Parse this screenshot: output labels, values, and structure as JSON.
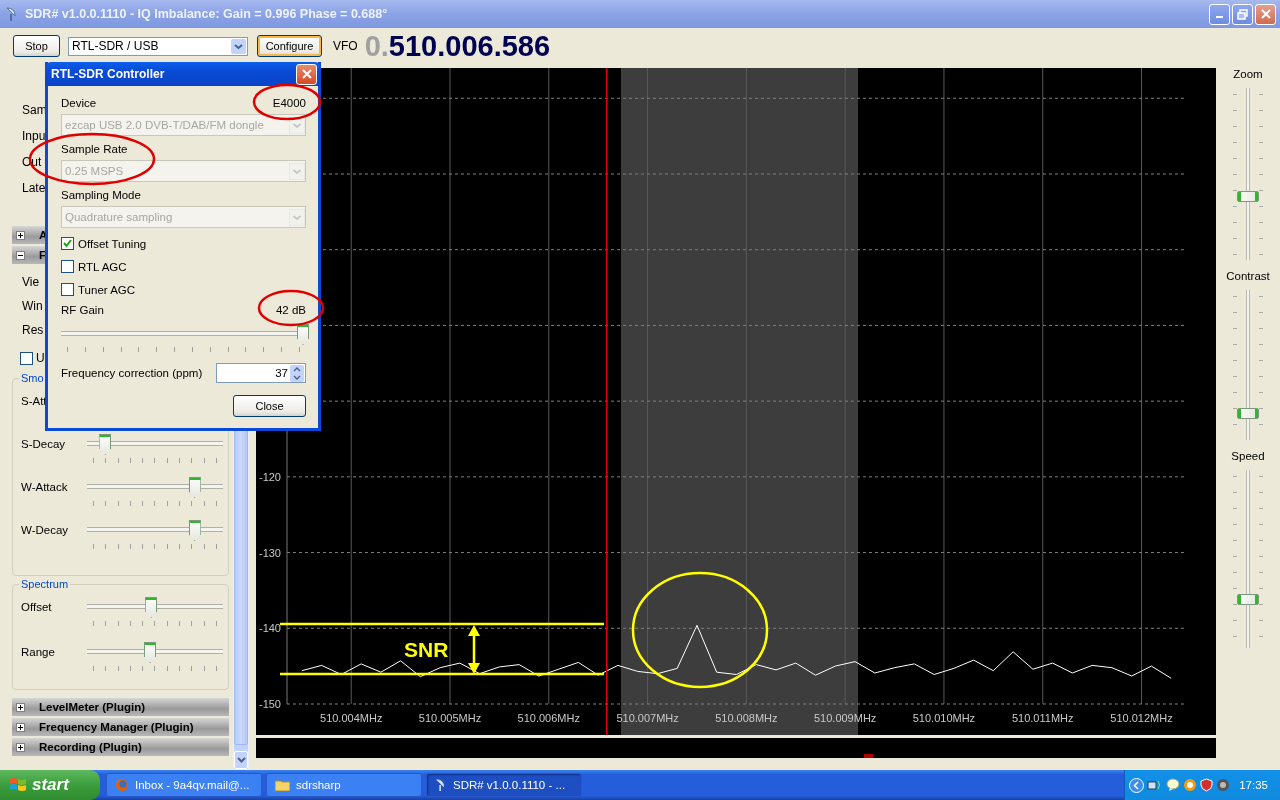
{
  "window": {
    "title": "SDR# v1.0.0.1110 - IQ Imbalance: Gain = 0.996 Phase = 0.688°"
  },
  "toolbar": {
    "stop_button": "Stop",
    "source": "RTL-SDR / USB",
    "configure_button": "Configure",
    "vfo_label": "VFO",
    "frequency_prefix": "0.",
    "frequency": "510.006.586"
  },
  "left_panel": {
    "top_labels": [
      "Sam",
      "Inpu",
      "Out",
      "Late"
    ],
    "sections": [
      {
        "title": "A",
        "expanded": false
      },
      {
        "title": "F",
        "expanded": true
      }
    ],
    "fft_labels": [
      "Vie",
      "Win",
      "Res"
    ],
    "checkbox": {
      "label": "U",
      "checked": false
    },
    "smoothing": {
      "legend": "Smo",
      "hidden_label": "S-Att",
      "sliders": [
        {
          "label": "S-Decay",
          "level": 0.1
        },
        {
          "label": "W-Attack",
          "level": 0.82
        },
        {
          "label": "W-Decay",
          "level": 0.82
        }
      ]
    },
    "spectrum": {
      "legend": "Spectrum",
      "sliders": [
        {
          "label": "Offset",
          "level": 0.47
        },
        {
          "label": "Range",
          "level": 0.46
        }
      ]
    },
    "plugins": [
      {
        "title": "LevelMeter (Plugin)",
        "expanded": false
      },
      {
        "title": "Frequency Manager (Plugin)",
        "expanded": false
      },
      {
        "title": "Recording (Plugin)",
        "expanded": false
      }
    ]
  },
  "spectrum_view": {
    "chart_data": {
      "type": "line",
      "x": [
        510.0035,
        510.0037,
        510.0039,
        510.0041,
        510.0043,
        510.0045,
        510.0047,
        510.0049,
        510.0051,
        510.0053,
        510.0055,
        510.0057,
        510.0059,
        510.0061,
        510.0063,
        510.0065,
        510.0067,
        510.0069,
        510.0071,
        510.0073,
        510.0075,
        510.0077,
        510.0079,
        510.0081,
        510.0083,
        510.0085,
        510.0087,
        510.0089,
        510.0091,
        510.0093,
        510.0095,
        510.0097,
        510.0099,
        510.0101,
        510.0103,
        510.0105,
        510.0107,
        510.0109,
        510.0111,
        510.0113,
        510.0115,
        510.0117,
        510.0119,
        510.0121,
        510.0123
      ],
      "series": [
        {
          "color": "#ffffff",
          "values": [
            -145.6,
            -144.9,
            -146.1,
            -144.7,
            -145.8,
            -144.3,
            -146.4,
            -145.2,
            -144.6,
            -146.0,
            -145.1,
            -144.8,
            -146.3,
            -145.4,
            -144.5,
            -146.2,
            -144.9,
            -145.7,
            -146.0,
            -145.3,
            -139.6,
            -145.8,
            -146.1,
            -144.8,
            -145.5,
            -144.6,
            -146.2,
            -145.0,
            -144.4,
            -145.9,
            -145.2,
            -144.7,
            -146.1,
            -145.3,
            -144.2,
            -145.6,
            -143.1,
            -145.4,
            -144.6,
            -145.9,
            -144.9,
            -145.2,
            -146.3,
            -145.0,
            -146.6
          ]
        }
      ],
      "xlim": [
        510.00335,
        510.01244
      ],
      "ylim": [
        -150,
        -66
      ],
      "xticks": [
        {
          "value": 510.004,
          "label": "510.004MHz"
        },
        {
          "value": 510.005,
          "label": "510.005MHz"
        },
        {
          "value": 510.006,
          "label": "510.006MHz"
        },
        {
          "value": 510.007,
          "label": "510.007MHz"
        },
        {
          "value": 510.008,
          "label": "510.008MHz"
        },
        {
          "value": 510.009,
          "label": "510.009MHz"
        },
        {
          "value": 510.01,
          "label": "510.010MHz"
        },
        {
          "value": 510.011,
          "label": "510.011MHz"
        },
        {
          "value": 510.012,
          "label": "510.012MHz"
        }
      ],
      "yticks": [
        -150,
        -140,
        -130,
        -120
      ],
      "grid": true,
      "bands": [
        {
          "axis": "x",
          "from": 510.00673,
          "to": 510.00913
        }
      ],
      "ref_lines": [
        {
          "axis": "x",
          "value": 510.006586
        }
      ]
    }
  },
  "right_panel": {
    "sliders": [
      {
        "label": "Zoom",
        "level": 0.36
      },
      {
        "label": "Contrast",
        "level": 0.15
      },
      {
        "label": "Speed",
        "level": 0.26
      }
    ]
  },
  "dialog": {
    "title": "RTL-SDR Controller",
    "device_label": "Device",
    "tuner": "E4000",
    "device": "ezcap USB 2.0 DVB-T/DAB/FM dongle",
    "sample_rate_label": "Sample Rate",
    "sample_rate": "0.25 MSPS",
    "sampling_mode_label": "Sampling Mode",
    "sampling_mode": "Quadrature sampling",
    "checkboxes": [
      {
        "label": "Offset Tuning",
        "checked": true
      },
      {
        "label": "RTL AGC",
        "checked": false
      },
      {
        "label": "Tuner AGC",
        "checked": false
      }
    ],
    "rf_gain_label": "RF Gain",
    "rf_gain": "42 dB",
    "rf_gain_slider": {
      "level": 1.0
    },
    "freq_correction_label": "Frequency correction (ppm)",
    "freq_correction": "37",
    "close_button": "Close"
  },
  "overlay": {
    "snr_label": "SNR"
  },
  "taskbar": {
    "start": "start",
    "tasks": [
      {
        "label": "Inbox - 9a4qv.mail@...",
        "kind": "browser",
        "selected": false
      },
      {
        "label": "sdrsharp",
        "kind": "folder",
        "selected": false
      },
      {
        "label": "SDR# v1.0.0.1110 - ...",
        "kind": "app",
        "selected": true
      }
    ],
    "clock": "17:35"
  }
}
